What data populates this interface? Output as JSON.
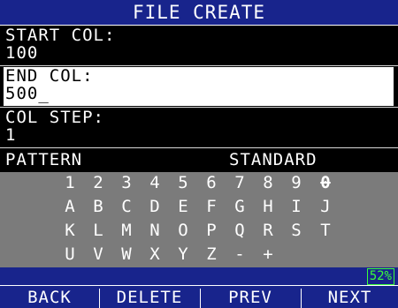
{
  "title": "FILE CREATE",
  "fields": {
    "start_col": {
      "label": "START COL:",
      "value": "100"
    },
    "end_col": {
      "label": "END COL:",
      "value": "500_"
    },
    "col_step": {
      "label": "COL STEP:",
      "value": "1"
    }
  },
  "pattern": {
    "label": "PATTERN",
    "value": "STANDARD"
  },
  "keyboard": {
    "rows": [
      [
        "1",
        "2",
        "3",
        "4",
        "5",
        "6",
        "7",
        "8",
        "9",
        "0"
      ],
      [
        "A",
        "B",
        "C",
        "D",
        "E",
        "F",
        "G",
        "H",
        "I",
        "J"
      ],
      [
        "K",
        "L",
        "M",
        "N",
        "O",
        "P",
        "Q",
        "R",
        "S",
        "T"
      ],
      [
        "U",
        "V",
        "W",
        "X",
        "Y",
        "Z",
        "-",
        "+"
      ]
    ],
    "selected_key": "0"
  },
  "status": {
    "battery": "52%"
  },
  "softkeys": {
    "back": "BACK",
    "delete": "DELETE",
    "prev": "PREV",
    "next": "NEXT"
  },
  "colors": {
    "bar_blue": "#18248c",
    "keyboard_gray": "#7b7b7b",
    "battery_green": "#3aff3a",
    "highlight": "#ffffff"
  }
}
